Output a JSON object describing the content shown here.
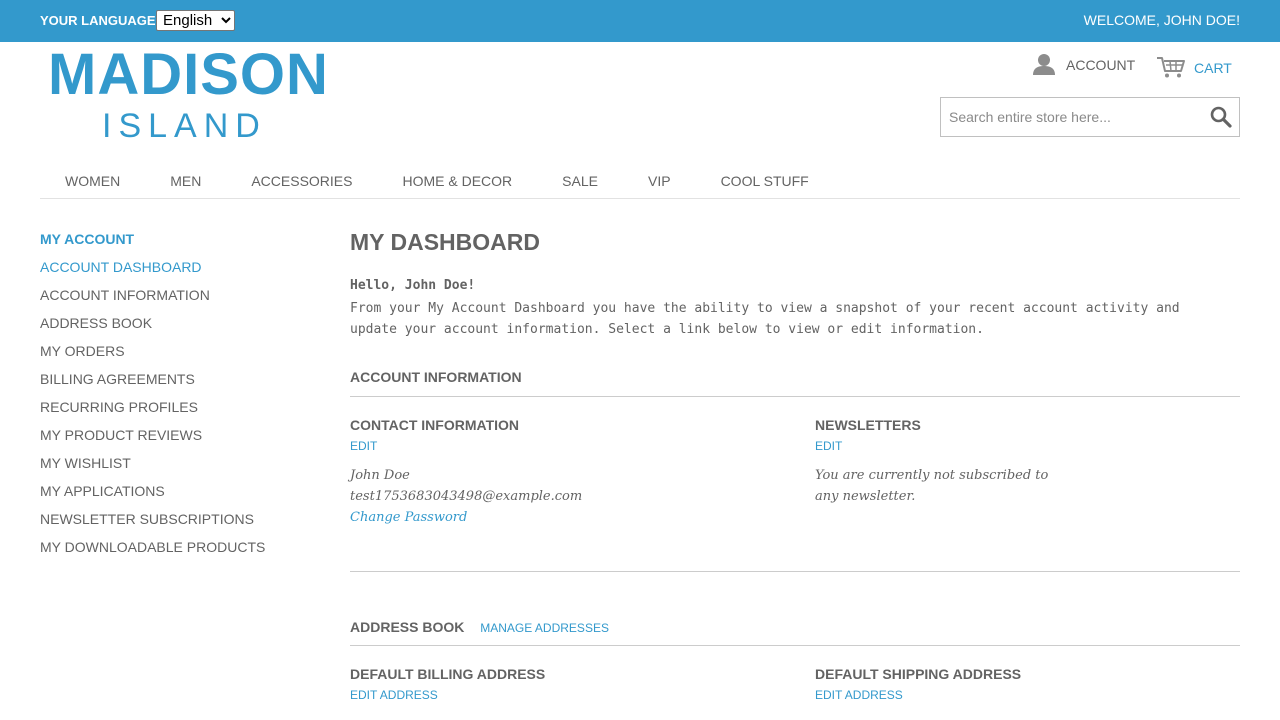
{
  "topbar": {
    "language_label": "YOUR LANGUAGE:",
    "language_selected": "English",
    "welcome": "WELCOME, JOHN DOE!"
  },
  "logo": {
    "line1": "MADISON",
    "line2": "ISLAND"
  },
  "header": {
    "account_label": "ACCOUNT",
    "cart_label": "CART",
    "search_placeholder": "Search entire store here..."
  },
  "nav": [
    "WOMEN",
    "MEN",
    "ACCESSORIES",
    "HOME & DECOR",
    "SALE",
    "VIP",
    "COOL STUFF"
  ],
  "sidebar": {
    "title": "MY ACCOUNT",
    "items": [
      "ACCOUNT DASHBOARD",
      "ACCOUNT INFORMATION",
      "ADDRESS BOOK",
      "MY ORDERS",
      "BILLING AGREEMENTS",
      "RECURRING PROFILES",
      "MY PRODUCT REVIEWS",
      "MY WISHLIST",
      "MY APPLICATIONS",
      "NEWSLETTER SUBSCRIPTIONS",
      "MY DOWNLOADABLE PRODUCTS"
    ]
  },
  "main": {
    "title": "MY DASHBOARD",
    "hello": "Hello, John Doe!",
    "intro": "From your My Account Dashboard you have the ability to view a snapshot of your recent account activity and update your account information. Select a link below to view or edit information.",
    "account_info": {
      "heading": "ACCOUNT INFORMATION",
      "contact": {
        "title": "CONTACT INFORMATION",
        "edit": "EDIT",
        "name": "John Doe",
        "email": "test1753683043498@example.com",
        "change_password": "Change Password"
      },
      "newsletters": {
        "title": "NEWSLETTERS",
        "edit": "EDIT",
        "text": "You are currently not subscribed to any newsletter."
      }
    },
    "address_book": {
      "heading": "ADDRESS BOOK",
      "manage": "MANAGE ADDRESSES",
      "billing": {
        "title": "DEFAULT BILLING ADDRESS",
        "edit": "EDIT ADDRESS"
      },
      "shipping": {
        "title": "DEFAULT SHIPPING ADDRESS",
        "edit": "EDIT ADDRESS"
      }
    }
  },
  "colors": {
    "brand": "#3399cc",
    "text": "#636363"
  }
}
